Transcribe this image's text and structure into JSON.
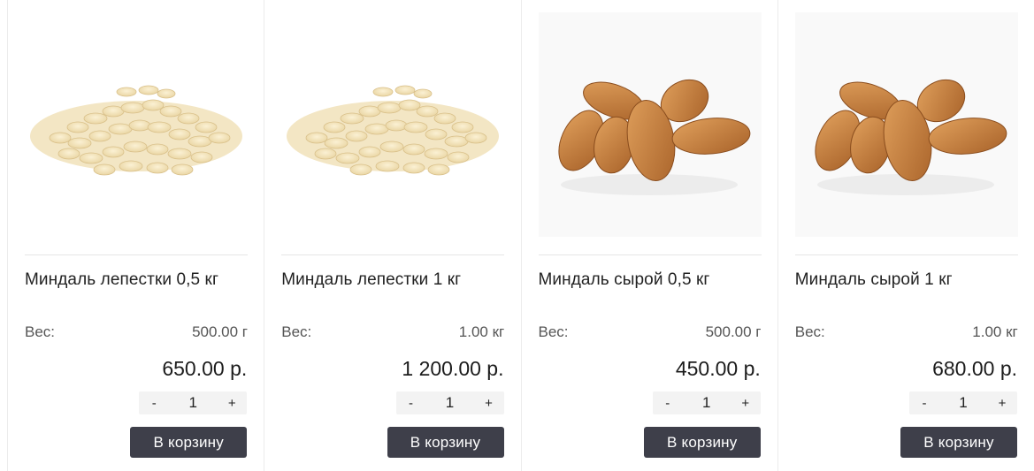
{
  "products": [
    {
      "name": "Миндаль лепестки 0,5 кг",
      "weight_label": "Вес:",
      "weight": "500.00 г",
      "price": "650.00 р.",
      "qty": "1",
      "minus": "-",
      "plus": "+",
      "cart_label": "В корзину",
      "image": "flaked-almonds"
    },
    {
      "name": "Миндаль лепестки 1 кг",
      "weight_label": "Вес:",
      "weight": "1.00 кг",
      "price": "1 200.00 р.",
      "qty": "1",
      "minus": "-",
      "plus": "+",
      "cart_label": "В корзину",
      "image": "flaked-almonds"
    },
    {
      "name": "Миндаль сырой 0,5 кг",
      "weight_label": "Вес:",
      "weight": "500.00 г",
      "price": "450.00 р.",
      "qty": "1",
      "minus": "-",
      "plus": "+",
      "cart_label": "В корзину",
      "image": "raw-almonds"
    },
    {
      "name": "Миндаль сырой 1 кг",
      "weight_label": "Вес:",
      "weight": "1.00 кг",
      "price": "680.00 р.",
      "qty": "1",
      "minus": "-",
      "plus": "+",
      "cart_label": "В корзину",
      "image": "raw-almonds"
    }
  ],
  "colors": {
    "button_bg": "#3e3f4a",
    "button_text": "#ffffff",
    "qty_bg": "#f3f3f3",
    "divider": "#e6e6e6"
  }
}
